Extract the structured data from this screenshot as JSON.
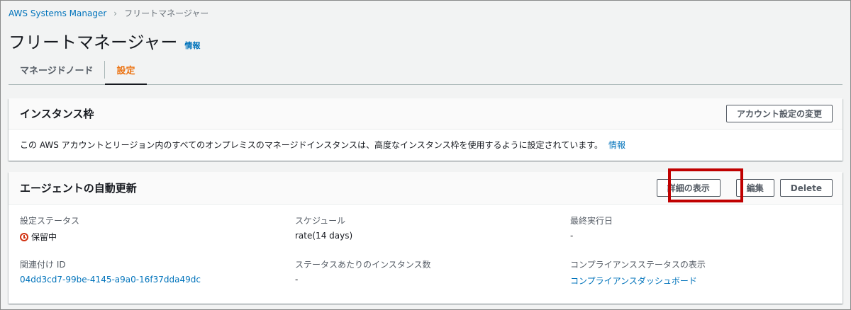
{
  "breadcrumb": {
    "parent": "AWS Systems Manager",
    "current": "フリートマネージャー"
  },
  "page": {
    "title": "フリートマネージャー",
    "info": "情報"
  },
  "tabs": [
    {
      "label": "マネージドノード",
      "active": false
    },
    {
      "label": "設定",
      "active": true
    }
  ],
  "instance_tier": {
    "title": "インスタンス枠",
    "change_button": "アカウント設定の変更",
    "description": "この AWS アカウントとリージョン内のすべてのオンプレミスのマネージドインスタンスは、高度なインスタンス枠を使用するように設定されています。",
    "info": "情報"
  },
  "agent_update": {
    "title": "エージェントの自動更新",
    "buttons": {
      "details": "詳細の表示",
      "edit": "編集",
      "delete": "Delete"
    },
    "fields": {
      "status_label": "設定ステータス",
      "status_value": "保留中",
      "status_icon": "pending-clock-icon",
      "schedule_label": "スケジュール",
      "schedule_value": "rate(14 days)",
      "last_run_label": "最終実行日",
      "last_run_value": "-",
      "association_label": "関連付け ID",
      "association_value": "04dd3cd7-99be-4145-a9a0-16f37dda49dc",
      "instances_label": "ステータスあたりのインスタンス数",
      "instances_value": "-",
      "compliance_label": "コンプライアンスステータスの表示",
      "compliance_value": "コンプライアンスダッシュボード"
    }
  },
  "colors": {
    "link": "#0073bb",
    "active_tab": "#ec7211",
    "highlight": "#c00000",
    "pending": "#d13212"
  }
}
